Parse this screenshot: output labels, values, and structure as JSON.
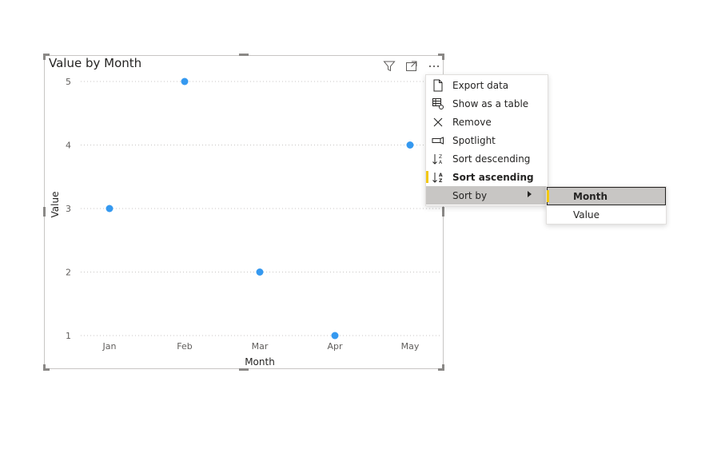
{
  "visual": {
    "title": "Value by Month",
    "header_icons": [
      "filter-icon",
      "focus-mode-icon",
      "more-options-icon"
    ]
  },
  "chart_data": {
    "type": "scatter",
    "title": "Value by Month",
    "xlabel": "Month",
    "ylabel": "Value",
    "categories": [
      "Jan",
      "Feb",
      "Mar",
      "Apr",
      "May"
    ],
    "values": [
      3,
      5,
      2,
      1,
      4
    ],
    "ylim": [
      1,
      5
    ],
    "yticks": [
      1,
      2,
      3,
      4,
      5
    ],
    "grid": true,
    "point_color": "#3599f0",
    "grid_color": "#c8c6c4"
  },
  "context_menu": {
    "items": [
      {
        "label": "Export data",
        "icon": "export-data-icon"
      },
      {
        "label": "Show as a table",
        "icon": "show-as-table-icon"
      },
      {
        "label": "Remove",
        "icon": "remove-icon"
      },
      {
        "label": "Spotlight",
        "icon": "spotlight-icon"
      },
      {
        "label": "Sort descending",
        "icon": "sort-descending-icon"
      },
      {
        "label": "Sort ascending",
        "icon": "sort-ascending-icon",
        "active": true
      },
      {
        "label": "Sort by",
        "has_submenu": true,
        "highlighted": true
      }
    ]
  },
  "submenu": {
    "items": [
      {
        "label": "Month",
        "selected": true
      },
      {
        "label": "Value"
      }
    ]
  },
  "colors": {
    "accent": "#f2c811",
    "point": "#3599f0",
    "menu_hover": "#c8c6c4"
  }
}
